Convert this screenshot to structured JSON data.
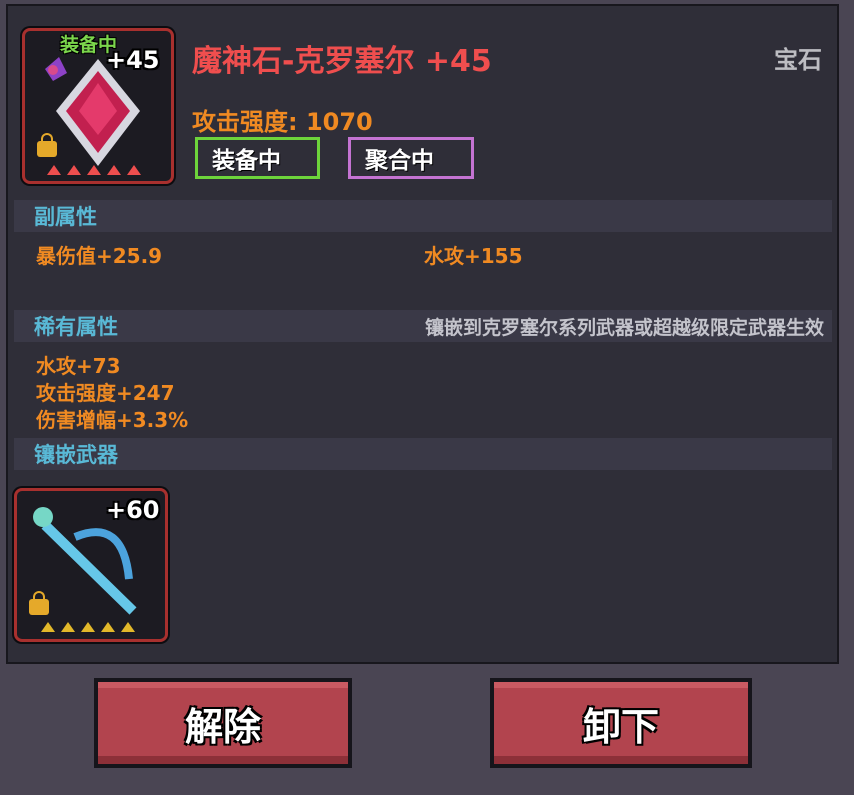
{
  "gem": {
    "equipped_label": "装备中",
    "level": "+45",
    "name": "魔神石-克罗塞尔 +45",
    "type": "宝石",
    "attack": "攻击强度: 1070",
    "badges": [
      "装备中",
      "聚合中"
    ]
  },
  "secondary": {
    "title": "副属性",
    "stats": [
      "暴伤值+25.9",
      "水攻+155"
    ]
  },
  "rare": {
    "title": "稀有属性",
    "note": "镶嵌到克罗塞尔系列武器或超越级限定武器生效",
    "stats": [
      "水攻+73",
      "攻击强度+247",
      "伤害增幅+3.3%"
    ]
  },
  "socket": {
    "title": "镶嵌武器",
    "weapon_level": "+60"
  },
  "buttons": {
    "remove": "解除",
    "unequip": "卸下"
  },
  "colors": {
    "frame": "#a8302e",
    "title": "#ef4e4e",
    "stat": "#f08a22",
    "section": "#59b9d6",
    "equip_badge": "#6dd43b",
    "fuse_badge": "#c473d2",
    "button": "#b2444e"
  },
  "icons": [
    "gem-icon",
    "bow-icon",
    "lock-icon",
    "star-icon"
  ]
}
